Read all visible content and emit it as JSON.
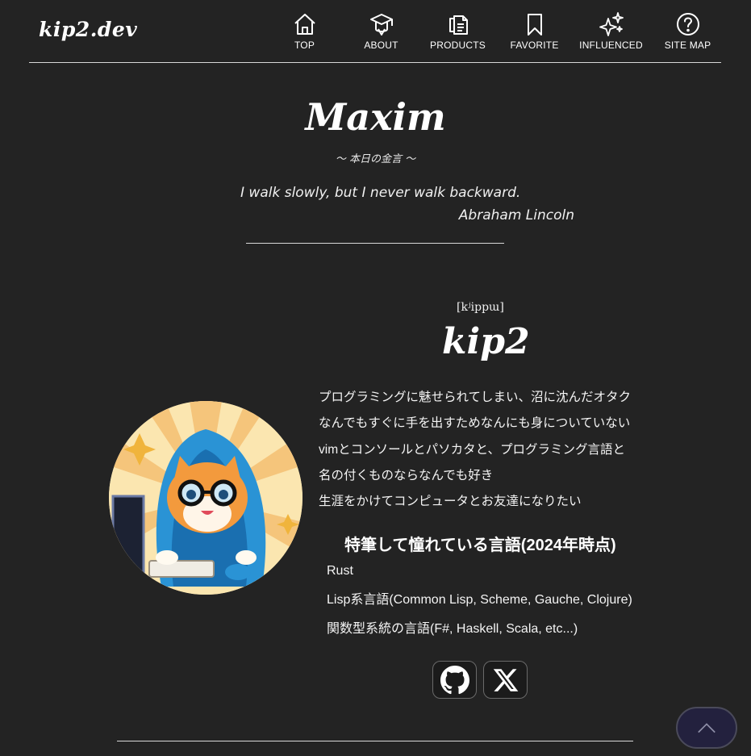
{
  "header": {
    "logo": "kip2.dev",
    "nav": [
      {
        "label": "TOP",
        "icon": "home-icon"
      },
      {
        "label": "ABOUT",
        "icon": "graduation-cap-icon"
      },
      {
        "label": "PRODUCTS",
        "icon": "documents-icon"
      },
      {
        "label": "FAVORITE",
        "icon": "bookmark-icon"
      },
      {
        "label": "INFLUENCED",
        "icon": "sparkles-icon"
      },
      {
        "label": "SITE MAP",
        "icon": "question-circle-icon"
      }
    ]
  },
  "maxim": {
    "title": "Maxim",
    "subtitle": "〜 本日の金言 〜",
    "quote": "I walk slowly, but I never walk backward.",
    "author": "Abraham Lincoln"
  },
  "profile": {
    "phonetic": "[kʲippɯ]",
    "name": "kip2",
    "bio": [
      "プログラミングに魅せられてしまい、沼に沈んだオタク",
      "なんでもすぐに手を出すためなんにも身についていない",
      "vimとコンソールとパソカタと、プログラミング言語と",
      "名の付くものならなんでも好き",
      "生涯をかけてコンピュータとお友達になりたい"
    ],
    "languages_heading": "特筆して憧れている言語(2024年時点)",
    "languages": [
      "Rust",
      "Lisp系言語(Common Lisp, Scheme, Gauche, Clojure)",
      "関数型系統の言語(F#, Haskell, Scala, etc...)"
    ],
    "social": [
      {
        "icon": "github-icon"
      },
      {
        "icon": "x-logo-icon"
      }
    ]
  },
  "colors": {
    "background": "#232323",
    "text": "#ffffff",
    "scroll_button": "#23213e"
  }
}
